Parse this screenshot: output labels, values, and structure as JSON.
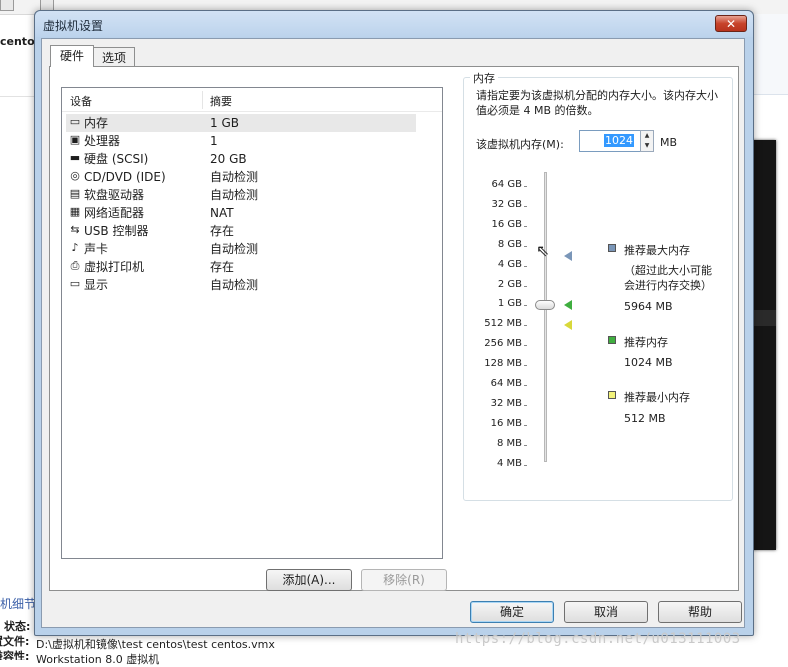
{
  "background": {
    "tab_label": "centos",
    "side_labels": [
      "机细节",
      "状态:",
      "置文件:",
      "兼容性:"
    ],
    "config_file_label": "配置文件:",
    "config_file_value": "D:\\虚拟机和镜像\\test centos\\test centos.vmx",
    "compat_value": "Workstation 8.0 虚拟机",
    "watermark": "https://blog.csdn.net/u013111003"
  },
  "dialog": {
    "title": "虚拟机设置",
    "close_label": "✕",
    "tabs": [
      {
        "label": "硬件",
        "active": true
      },
      {
        "label": "选项",
        "active": false
      }
    ],
    "device_list": {
      "col_device": "设备",
      "col_summary": "摘要",
      "devices": [
        {
          "icon": "memory-icon",
          "glyph": "▭",
          "name": "内存",
          "summary": "1 GB",
          "selected": true
        },
        {
          "icon": "processor-icon",
          "glyph": "▣",
          "name": "处理器",
          "summary": "1",
          "selected": false
        },
        {
          "icon": "hard-disk-icon",
          "glyph": "▬",
          "name": "硬盘 (SCSI)",
          "summary": "20 GB",
          "selected": false
        },
        {
          "icon": "cd-dvd-icon",
          "glyph": "◎",
          "name": "CD/DVD (IDE)",
          "summary": "自动检测",
          "selected": false
        },
        {
          "icon": "floppy-icon",
          "glyph": "▤",
          "name": "软盘驱动器",
          "summary": "自动检测",
          "selected": false
        },
        {
          "icon": "network-adapter-icon",
          "glyph": "▦",
          "name": "网络适配器",
          "summary": "NAT",
          "selected": false
        },
        {
          "icon": "usb-controller-icon",
          "glyph": "⇆",
          "name": "USB 控制器",
          "summary": "存在",
          "selected": false
        },
        {
          "icon": "sound-card-icon",
          "glyph": "♪",
          "name": "声卡",
          "summary": "自动检测",
          "selected": false
        },
        {
          "icon": "printer-icon",
          "glyph": "⎙",
          "name": "虚拟打印机",
          "summary": "存在",
          "selected": false
        },
        {
          "icon": "display-icon",
          "glyph": "▭",
          "name": "显示",
          "summary": "自动检测",
          "selected": false
        }
      ],
      "add_label": "添加(A)...",
      "remove_label": "移除(R)"
    },
    "memory": {
      "legend": "内存",
      "description": "请指定要为该虚拟机分配的内存大小。该内存大小值必须是 4 MB 的倍数。",
      "input_label": "该虚拟机内存(M):",
      "input_value": "1024",
      "unit": "MB",
      "scale": [
        "64 GB",
        "32 GB",
        "16 GB",
        "8 GB",
        "4 GB",
        "2 GB",
        "1 GB",
        "512 MB",
        "256 MB",
        "128 MB",
        "64 MB",
        "32 MB",
        "16 MB",
        "8 MB",
        "4 MB"
      ],
      "current_index": 6,
      "markers": [
        {
          "name": "max",
          "index": 3.5,
          "color": "#7a96b8"
        },
        {
          "name": "recommended",
          "index": 6,
          "color": "#3fae3f"
        },
        {
          "name": "min",
          "index": 7,
          "color": "#d8d83a"
        }
      ],
      "recommended_max": {
        "label": "推荐最大内存",
        "note_line1": "（超过此大小可能",
        "note_line2": "会进行内存交换）",
        "value": "5964 MB",
        "color": "#7a96b8"
      },
      "recommended": {
        "label": "推荐内存",
        "value": "1024 MB",
        "color": "#3fae3f"
      },
      "recommended_min": {
        "label": "推荐最小内存",
        "value": "512 MB",
        "color": "#f2f27a"
      }
    },
    "buttons": {
      "ok": "确定",
      "cancel": "取消",
      "help": "帮助"
    }
  }
}
